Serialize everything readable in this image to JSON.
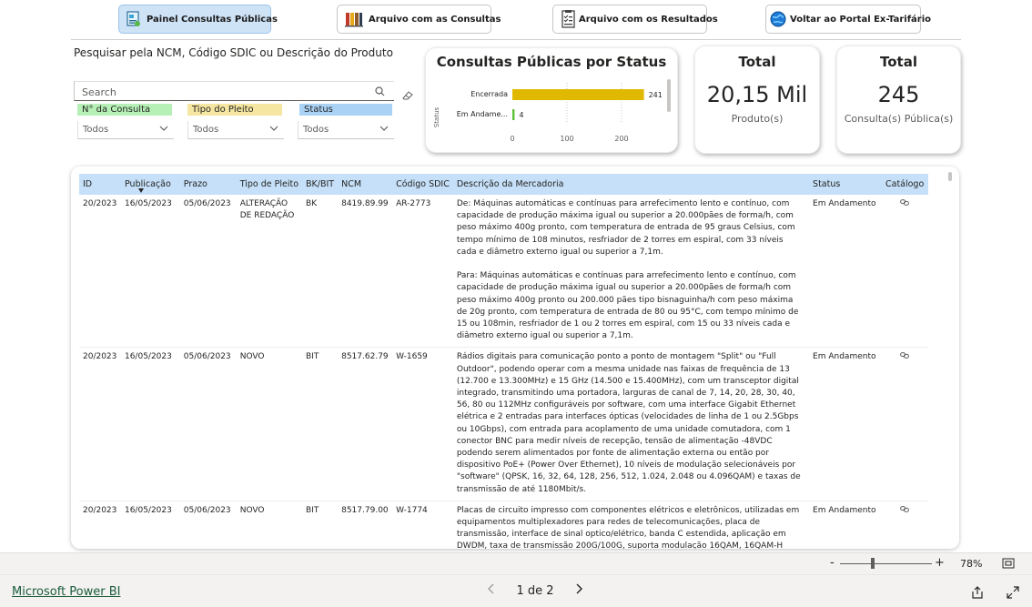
{
  "nav": {
    "buttons": [
      {
        "label": "Painel Consultas Públicas",
        "icon": "dashboard-icon",
        "active": true
      },
      {
        "label": "Arquivo com as Consultas",
        "icon": "archive-icon",
        "active": false
      },
      {
        "label": "Arquivo com os Resultados",
        "icon": "checklist-icon",
        "active": false
      },
      {
        "label": "Voltar ao Portal Ex-Tarifário",
        "icon": "globe-icon",
        "active": false
      }
    ]
  },
  "search": {
    "title": "Pesquisar pela NCM, Código SDIC ou Descrição do Produto",
    "placeholder": "Search"
  },
  "slicers": [
    {
      "label": "N° da Consulta",
      "value": "Todos",
      "color": "#b6f0b6"
    },
    {
      "label": "Tipo do Pleito",
      "value": "Todos",
      "color": "#f5e6a1"
    },
    {
      "label": "Status",
      "value": "Todos",
      "color": "#a9d2f5"
    }
  ],
  "status_card": {
    "title": "Consultas Públicas por Status",
    "ylabel": "Status"
  },
  "chart_data": {
    "type": "bar",
    "orientation": "horizontal",
    "title": "Consultas Públicas por Status",
    "ylabel": "Status",
    "xlabel": "",
    "categories": [
      "Encerrada",
      "Em Andame..."
    ],
    "values": [
      241,
      4
    ],
    "colors": [
      "#e0b800",
      "#5bc236"
    ],
    "xticks": [
      "0",
      "100",
      "200"
    ],
    "xlim": [
      0,
      280
    ],
    "data_labels": [
      "241",
      "4"
    ]
  },
  "total_produtos": {
    "title": "Total",
    "value": "20,15 Mil",
    "sub": "Produto(s)"
  },
  "total_consultas": {
    "title": "Total",
    "value": "245",
    "sub": "Consulta(s) Pública(s)"
  },
  "table": {
    "headers": [
      "ID",
      "Publicação",
      "Prazo",
      "Tipo de Pleito",
      "BK/BIT",
      "NCM",
      "Código SDIC",
      "Descrição da Mercadoria",
      "Status",
      "Catálogo"
    ],
    "rows": [
      {
        "id": "20/2023",
        "publicacao": "16/05/2023",
        "prazo": "05/06/2023",
        "tipo": "ALTERAÇÃO DE REDAÇÃO",
        "bkbit": "BK",
        "ncm": "8419.89.99",
        "sdic": "AR-2773",
        "descricao": "De: Máquinas automáticas e contínuas para arrefecimento lento e contínuo, com capacidade de produção máxima igual ou superior a 20.000pães de forma/h, com peso máximo 400g pronto, com temperatura de entrada de 95 graus Celsius, com tempo mínimo de 108 minutos, resfriador de 2 torres em espiral, com 33 níveis cada e diâmetro externo igual ou superior a 7,1m.\n\nPara: Máquinas automáticas e contínuas para arrefecimento lento e contínuo, com capacidade de produção máxima igual ou superior a 20.000pães de forma/h com peso máximo 400g pronto ou 200.000 pães tipo bisnaguinha/h com peso máxima de 20g pronto, com temperatura de entrada de 80 ou 95°C, com tempo mínimo de 15 ou 108min, resfriador de 1 ou 2 torres em espiral, com 15 ou 33 níveis cada e diâmetro externo igual ou superior a 7,1m.",
        "status": "Em Andamento"
      },
      {
        "id": "20/2023",
        "publicacao": "16/05/2023",
        "prazo": "05/06/2023",
        "tipo": "NOVO",
        "bkbit": "BIT",
        "ncm": "8517.62.79",
        "sdic": "W-1659",
        "descricao": "Rádios digitais para comunicação ponto a ponto de montagem \"Split\" ou \"Full Outdoor\", podendo operar com a mesma unidade nas faixas de frequência de 13 (12.700 e 13.300MHz) e 15 GHz (14.500 e 15.400MHz), com um transceptor digital integrado, transmitindo uma portadora, larguras de canal de 7, 14, 20, 28, 30, 40, 56, 80 ou 112MHz configuráveis por software, com uma interface Gigabit Ethernet elétrica e 2 entradas para interfaces ópticas (velocidades de linha de 1 ou 2.5Gbps ou 10Gbps), com entrada para acoplamento de uma unidade comutadora, com 1 conector BNC para medir níveis de recepção, tensão de alimentação -48VDC podendo serem alimentados por fonte de alimentação externa ou então por dispositivo PoE+ (Power Over Ethernet), 10 níveis de modulação selecionáveis por \"software\" (QPSK, 16, 32, 64, 128, 256, 512, 1.024, 2.048 ou 4.096QAM) e taxas de transmissão de até 1180Mbit/s.",
        "status": "Em Andamento"
      },
      {
        "id": "20/2023",
        "publicacao": "16/05/2023",
        "prazo": "05/06/2023",
        "tipo": "NOVO",
        "bkbit": "BIT",
        "ncm": "8517.79.00",
        "sdic": "W-1774",
        "descricao": "Placas de circuito impresso com componentes elétricos e eletrônicos, utilizadas em equipamentos multiplexadores para redes de telecomunicações, placa de transmissão, interface de sinal optico/elétrico, banda C estendida, aplicação em DWDM, taxa de transmissão 200G/100G, suporta modulação 16QAM, 16QAM-H",
        "status": "Em Andamento"
      }
    ]
  },
  "zoom": {
    "minus": "-",
    "plus": "+",
    "percent": "78%"
  },
  "footer": {
    "brand": "Microsoft Power BI",
    "page": "1 de 2"
  }
}
